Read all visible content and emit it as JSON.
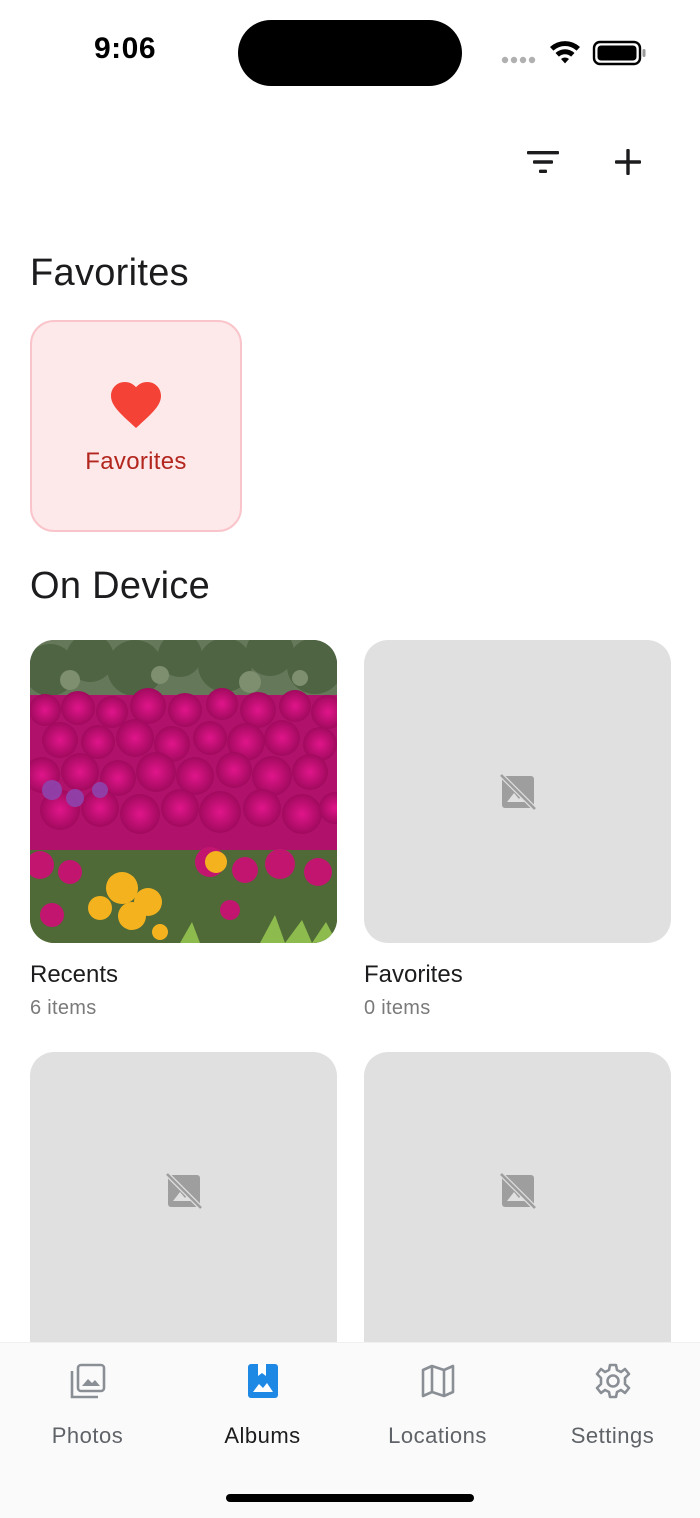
{
  "status": {
    "time": "9:06",
    "icons": [
      "signal-dots-icon",
      "wifi-icon",
      "battery-icon"
    ]
  },
  "toolbar": {
    "filter_icon": "filter-icon",
    "add_icon": "plus-icon"
  },
  "sections": {
    "favorites_title": "Favorites",
    "on_device_title": "On Device"
  },
  "favorites_card": {
    "label": "Favorites",
    "icon": "heart-icon",
    "color": "#f44336"
  },
  "albums": [
    {
      "name": "Recents",
      "count": "6 items",
      "thumbnail": "photo"
    },
    {
      "name": "Favorites",
      "count": "0 items",
      "thumbnail": "no-image-icon"
    },
    {
      "name": "",
      "count": "",
      "thumbnail": "no-image-icon"
    },
    {
      "name": "",
      "count": "",
      "thumbnail": "no-image-icon"
    }
  ],
  "nav": {
    "items": [
      {
        "label": "Photos",
        "icon": "photos-icon",
        "active": false
      },
      {
        "label": "Albums",
        "icon": "album-icon",
        "active": true
      },
      {
        "label": "Locations",
        "icon": "map-icon",
        "active": false
      },
      {
        "label": "Settings",
        "icon": "gear-icon",
        "active": false
      }
    ],
    "active_color": "#1e88e5"
  }
}
